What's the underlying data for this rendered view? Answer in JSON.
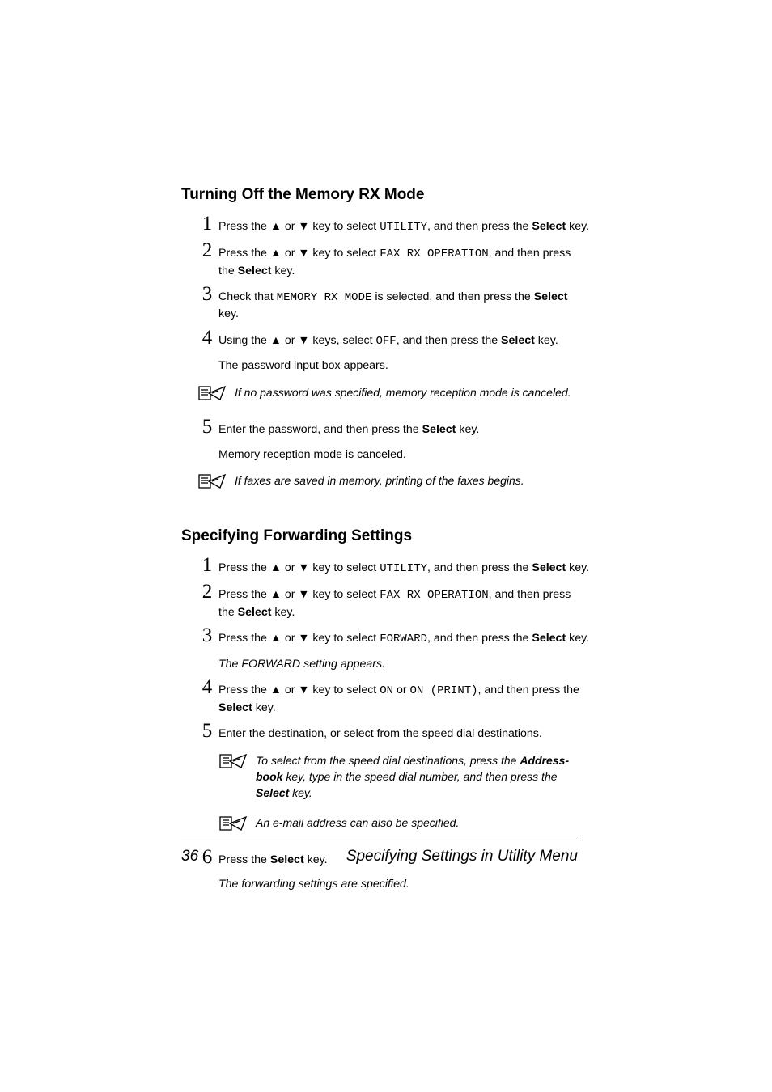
{
  "section1": {
    "title": "Turning Off the Memory RX Mode",
    "steps": [
      {
        "n": "1",
        "pre": "Press the ▲ or ▼ key to select ",
        "mono": "UTILITY",
        "post": ", and then press the ",
        "bold": "Select",
        "tail": " key."
      },
      {
        "n": "2",
        "pre": "Press the ▲ or ▼ key to select ",
        "mono": "FAX RX OPERATION",
        "post": ", and then press the ",
        "bold": "Select",
        "tail": " key."
      },
      {
        "n": "3",
        "pre": "Check that ",
        "mono": "MEMORY RX MODE",
        "post": " is selected, and then press the ",
        "bold": "Select",
        "tail": " key."
      },
      {
        "n": "4",
        "pre": "Using the ▲ or ▼ keys, select ",
        "mono": "OFF",
        "post": ", and then press the ",
        "bold": "Select",
        "tail": " key.",
        "sub": "The password input box appears."
      }
    ],
    "note1": "If no password was specified, memory reception mode is canceled.",
    "step5": {
      "n": "5",
      "text": "Enter the password, and then press the ",
      "bold": "Select",
      "tail": " key.",
      "sub": "Memory reception mode is canceled."
    },
    "note2": "If faxes are saved in memory, printing of the faxes begins."
  },
  "section2": {
    "title": "Specifying Forwarding Settings",
    "steps": [
      {
        "n": "1",
        "pre": "Press the ▲ or ▼ key to select ",
        "mono": "UTILITY",
        "post": ", and then press the ",
        "bold": "Select",
        "tail": " key."
      },
      {
        "n": "2",
        "pre": "Press the ▲ or ▼ key to select ",
        "mono": "FAX RX OPERATION",
        "post": ", and then press the ",
        "bold": "Select",
        "tail": " key."
      },
      {
        "n": "3",
        "pre": "Press the ▲ or ▼ key to select ",
        "mono": "FORWARD",
        "post": ", and then press the ",
        "bold": "Select",
        "tail": " key.",
        "subItalic": "The FORWARD setting appears."
      },
      {
        "n": "4",
        "pre": "Press the ▲ or ▼ key to select ",
        "mono": "ON",
        "mid": " or ",
        "mono2": "ON (PRINT)",
        "post": ", and then press the ",
        "bold": "Select",
        "tail": " key."
      },
      {
        "n": "5",
        "plain": "Enter the destination, or select from the speed dial destinations."
      }
    ],
    "noteA_pre": "To select from the speed dial destinations, press the ",
    "noteA_b1": "Address-book",
    "noteA_mid": " key, type in the speed dial number, and then press the ",
    "noteA_b2": "Select",
    "noteA_tail": " key.",
    "noteB": "An e-mail address can also be specified.",
    "step6": {
      "n": "6",
      "text": "Press the ",
      "bold": "Select",
      "tail": " key.",
      "subItalic": "The forwarding settings are specified."
    }
  },
  "footer": {
    "page": "36",
    "title": "Specifying Settings in Utility Menu"
  }
}
